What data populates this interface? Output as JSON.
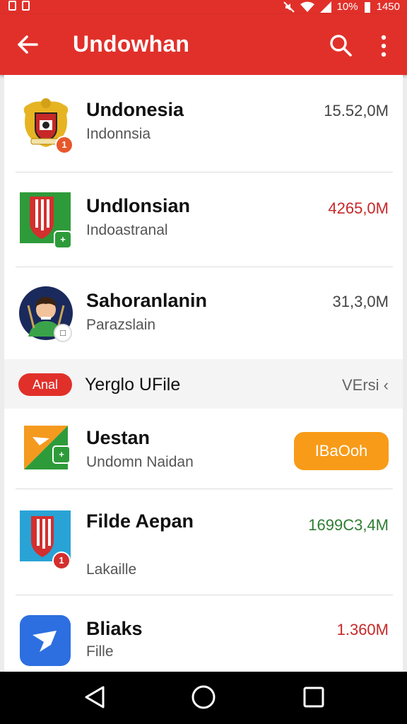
{
  "status_bar": {
    "battery_text": "10%",
    "time": "1450"
  },
  "app_bar": {
    "title": "Undowhan",
    "back_icon": "arrow-left-icon",
    "search_icon": "search-icon",
    "more_icon": "more-vertical-icon"
  },
  "items": [
    {
      "name": "Undonesia",
      "subtitle": "Indonnsia",
      "size": "15.52,0M",
      "size_color": "#444444",
      "badge": "1",
      "icon": "coat-of-arms-icon"
    },
    {
      "name": "Undlonsian",
      "subtitle": "Indoastranal",
      "size": "4265,0M",
      "size_color": "#c62828",
      "icon": "flag-shield-icon"
    },
    {
      "name": "Sahoranlanin",
      "subtitle": "Parazslain",
      "size": "31,3,0M",
      "size_color": "#444444",
      "icon": "avatar-icon"
    }
  ],
  "section": {
    "pill": "Anal",
    "title": "Yerglo UFile",
    "right": "VErsi"
  },
  "items2": [
    {
      "name": "Uestan",
      "subtitle": "Undomn Naidan",
      "button": "IBaOoh",
      "icon": "swirl-app-icon"
    },
    {
      "name": "Filde Aepan",
      "subtitle": "Lakaille",
      "size": "1699C3,4M",
      "size_color": "#2e7d32",
      "badge": "1",
      "icon": "flag-shield-blue-icon"
    },
    {
      "name": "Bliaks",
      "subtitle": "Fille",
      "size": "1.360M",
      "size_color": "#c62828",
      "icon": "blue-app-icon"
    }
  ],
  "colors": {
    "primary": "#e1302a",
    "accent_orange": "#f89b18",
    "green": "#2e7d32"
  }
}
